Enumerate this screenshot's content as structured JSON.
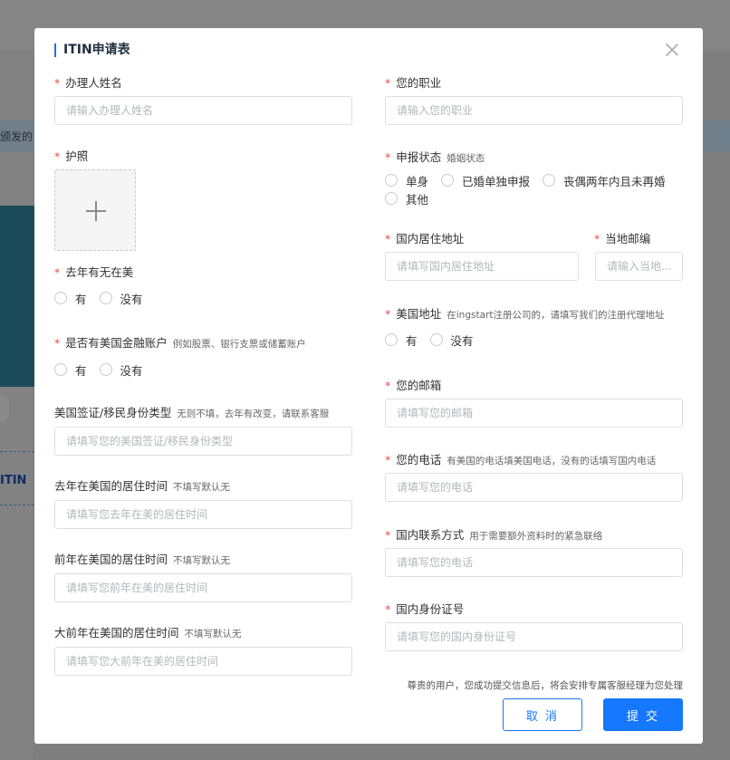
{
  "background": {
    "notice_text": "颁发的",
    "itin_label": "ITIN"
  },
  "modal": {
    "title": "ITIN申请表",
    "left": {
      "applicant_name": {
        "label": "办理人姓名",
        "placeholder": "请输入办理人姓名"
      },
      "passport": {
        "label": "护照"
      },
      "in_us_last_year": {
        "label": "去年有无在美",
        "options": [
          "有",
          "没有"
        ]
      },
      "us_financial_account": {
        "label": "是否有美国金融账户",
        "hint": "例如股票、银行支票或储蓄账户",
        "options": [
          "有",
          "没有"
        ]
      },
      "visa_type": {
        "label": "美国签证/移民身份类型",
        "hint": "无则不填，去年有改变，请联系客服",
        "placeholder": "请填写您的美国签证/移民身份类型"
      },
      "residence_last_year": {
        "label": "去年在美国的居住时间",
        "hint": "不填写默认无",
        "placeholder": "请填写您去年在美的居住时间"
      },
      "residence_2y_ago": {
        "label": "前年在美国的居住时间",
        "hint": "不填写默认无",
        "placeholder": "请填写您前年在美的居住时间"
      },
      "residence_3y_ago": {
        "label": "大前年在美国的居住时间",
        "hint": "不填写默认无",
        "placeholder": "请填写您大前年在美的居住时间"
      }
    },
    "right": {
      "occupation": {
        "label": "您的职业",
        "placeholder": "请输入您的职业"
      },
      "filing_status": {
        "label": "申报状态",
        "hint": "婚姻状态",
        "options": [
          "单身",
          "已婚单独申报",
          "丧偶两年内且未再婚",
          "其他"
        ]
      },
      "domestic_address": {
        "label": "国内居住地址",
        "placeholder": "请填写国内居住地址"
      },
      "postal_code": {
        "label": "当地邮编",
        "placeholder": "请输入当地..."
      },
      "us_address": {
        "label": "美国地址",
        "hint": "在ingstart注册公司的，请填写我们的注册代理地址",
        "options": [
          "有",
          "没有"
        ]
      },
      "email": {
        "label": "您的邮箱",
        "placeholder": "请填写您的邮箱"
      },
      "phone": {
        "label": "您的电话",
        "hint": "有美国的电话填美国电话，没有的话填写国内电话",
        "placeholder": "请填写您的电话"
      },
      "domestic_contact": {
        "label": "国内联系方式",
        "hint": "用于需要额外资料时的紧急联络",
        "placeholder": "请填写您的电话"
      },
      "id_number": {
        "label": "国内身份证号",
        "placeholder": "请填写您的国内身份证号"
      }
    },
    "footer_note": "尊贵的用户，您成功提交信息后，将会安排专属客服经理为您处理",
    "cancel_label": "取 消",
    "submit_label": "提 交",
    "required_mark": "*"
  }
}
